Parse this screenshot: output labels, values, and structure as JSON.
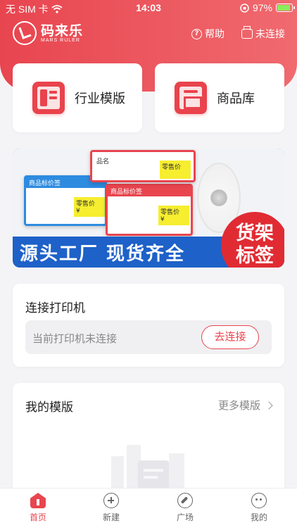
{
  "status_bar": {
    "carrier": "无 SIM 卡",
    "time": "14:03",
    "battery": "97%",
    "battery_level": 0.97
  },
  "navbar": {
    "logo_text": "码来乐",
    "logo_subtext": "MARS RULER",
    "help_label": "帮助",
    "connection_label": "未连接"
  },
  "quick_actions": [
    {
      "label": "行业模版"
    },
    {
      "label": "商品库"
    }
  ],
  "banner": {
    "strip_text": "源头工厂 现货齐全",
    "badge_text": "货架标签",
    "label_heading": "商品标价签",
    "label_price_field": "零售价",
    "label_currency": "¥",
    "label_field_name": "品名"
  },
  "printer": {
    "title": "连接打印机",
    "status_text": "当前打印机未连接",
    "connect_button": "去连接"
  },
  "templates": {
    "title": "我的模版",
    "more_link": "更多模版"
  },
  "tabbar": {
    "items": [
      {
        "label": "首页",
        "icon": "home-icon",
        "active": true
      },
      {
        "label": "新建",
        "icon": "plus-circle-icon",
        "active": false
      },
      {
        "label": "广场",
        "icon": "compass-icon",
        "active": false
      },
      {
        "label": "我的",
        "icon": "chat-face-icon",
        "active": false
      }
    ]
  },
  "colors": {
    "brand": "#e8454f",
    "background": "#f4f4f6",
    "banner_blue": "#1e61c8"
  }
}
